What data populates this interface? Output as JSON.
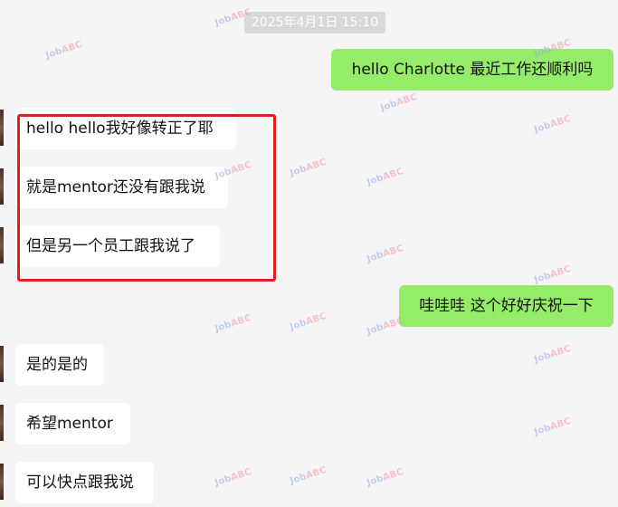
{
  "timestamp": "2025年4月1日 15:10",
  "watermark": {
    "part1": "Job",
    "part2": "ABC"
  },
  "messages": [
    {
      "side": "out",
      "text": "hello  Charlotte 最近工作还顺利吗"
    },
    {
      "side": "in",
      "text": "hello hello我好像转正了耶"
    },
    {
      "side": "in",
      "text": "就是mentor还没有跟我说"
    },
    {
      "side": "in",
      "text": "但是另一个员工跟我说了"
    },
    {
      "side": "out",
      "text": "哇哇哇  这个好好庆祝一下"
    },
    {
      "side": "in",
      "text": "是的是的"
    },
    {
      "side": "in",
      "text": "希望mentor"
    },
    {
      "side": "in",
      "text": "可以快点跟我说"
    }
  ],
  "colors": {
    "background": "#f5f5f5",
    "outgoing_bubble": "#95ec69",
    "incoming_bubble": "#ffffff",
    "highlight": "#e02020"
  }
}
